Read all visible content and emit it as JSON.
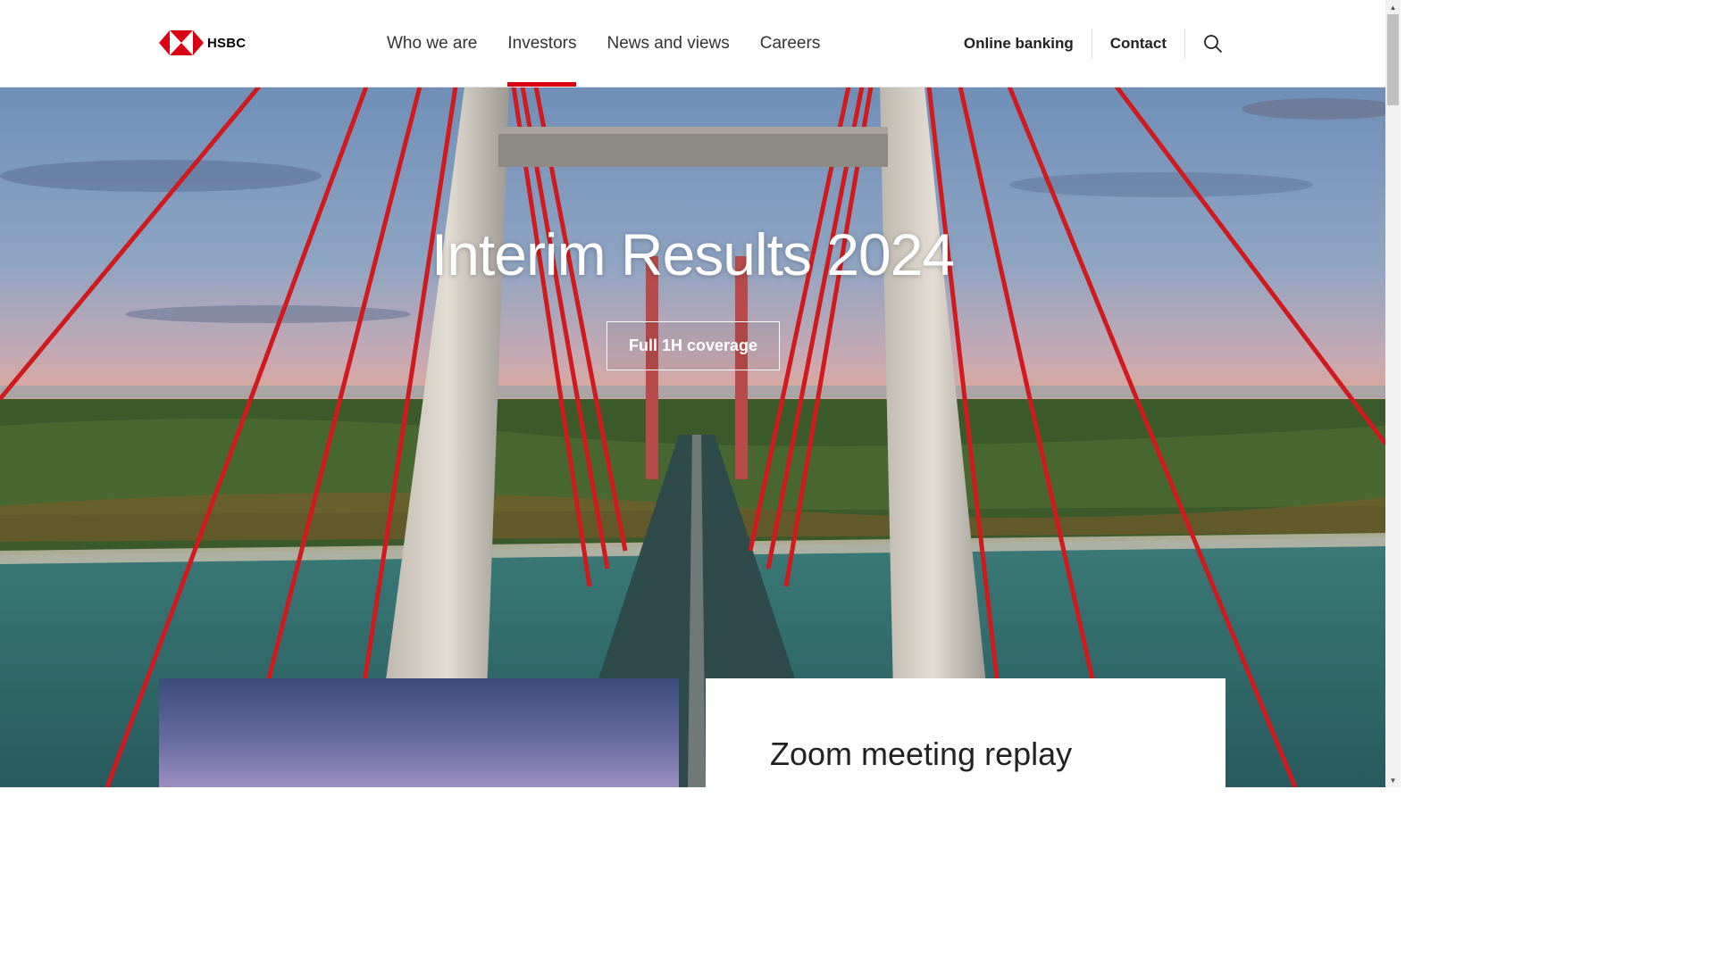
{
  "brand": {
    "name": "HSBC"
  },
  "nav": {
    "items": [
      {
        "label": "Who we are",
        "active": false
      },
      {
        "label": "Investors",
        "active": true
      },
      {
        "label": "News and views",
        "active": false
      },
      {
        "label": "Careers",
        "active": false
      }
    ]
  },
  "utility": {
    "online_banking": "Online banking",
    "contact": "Contact",
    "search_icon": "search-icon"
  },
  "hero": {
    "title": "Interim Results 2024",
    "button": "Full 1H coverage"
  },
  "cards": {
    "second_title": "Zoom meeting replay"
  },
  "colors": {
    "accent": "#db0011",
    "text": "#333333"
  }
}
